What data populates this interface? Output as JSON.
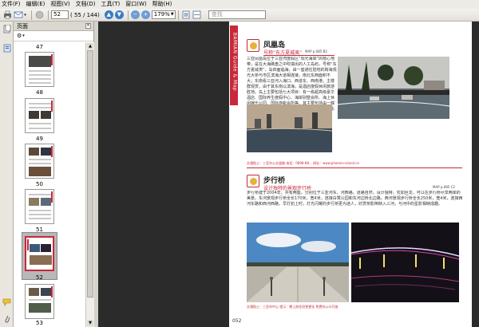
{
  "menu": [
    "文件(F)",
    "编辑(E)",
    "视图(V)",
    "文档(D)",
    "工具(T)",
    "窗口(W)",
    "帮助(H)"
  ],
  "toolbar": {
    "page_number": "52",
    "page_count": "( 55 / 144)",
    "zoom": "179%",
    "search_placeholder": "查找"
  },
  "panel": {
    "title": "页面",
    "thumbnails": [
      "47",
      "48",
      "49",
      "50",
      "51",
      "52",
      "53"
    ],
    "selected": "52"
  },
  "document": {
    "side_banner": "BAMIAN Guide & Map",
    "section1": {
      "title": "凤凰岛",
      "subtitle": "号称“东方夏威夷”",
      "map_tag": "MAP p.085 B2",
      "text": "三亚凤凰岛位于三亚湾度假区“阳光海岸”的核心地带，是在大海礁盘之中吹填出的人工岛屿，号称“东方夏威夷”。岛四面临海，由一座通往陆地的跨海观光大桥与市区滨海大道相连接，南北东西面积不大；东南看三亚河入海口、西进东、西南港，主楼群观赏，由于其东南以滨海，是酒店度假休闲旅游胜地。岛上主要包括七大项目：有一栋超高级豪华酒店、国际养生度假中心、海岸别墅会所、海上休闲娱乐公园、国际游艇会所等。其主要包括由一幢超五星级的酒店、酒店配套，所有的设计都充满东南亚风情，是拍婚纱照和度假的好去处。",
      "info": "交通贴士：三亚市公交道路 电话：0898-88...  网址：www.phoenix-island.cn"
    },
    "section2": {
      "title": "步行桥",
      "subtitle": "设计独特的景观步行桥",
      "map_tag": "MAP p.085 C2",
      "text": "步行桥建于2004年，共有两座，分别位于三亚河东、河西路。道路自然，设计独特，犹如丝龙，可以在步行桥尽享两岸的美景。东河景观步行桥全长170米，宽4米，连接白鹭公园和东河边桥北边路。西河景观步行桥全长250米，宽4米，连接西河东路和西河西路。早灯初上时，灯光闪耀的步行桥更为迷人，欣赏桥影倒映入三河，与河中的星影相映成趣。",
      "info": "交通贴士：三亚市中心 提示：晚上前往欣赏更佳  免费向公众开放"
    },
    "page_number": "052"
  }
}
